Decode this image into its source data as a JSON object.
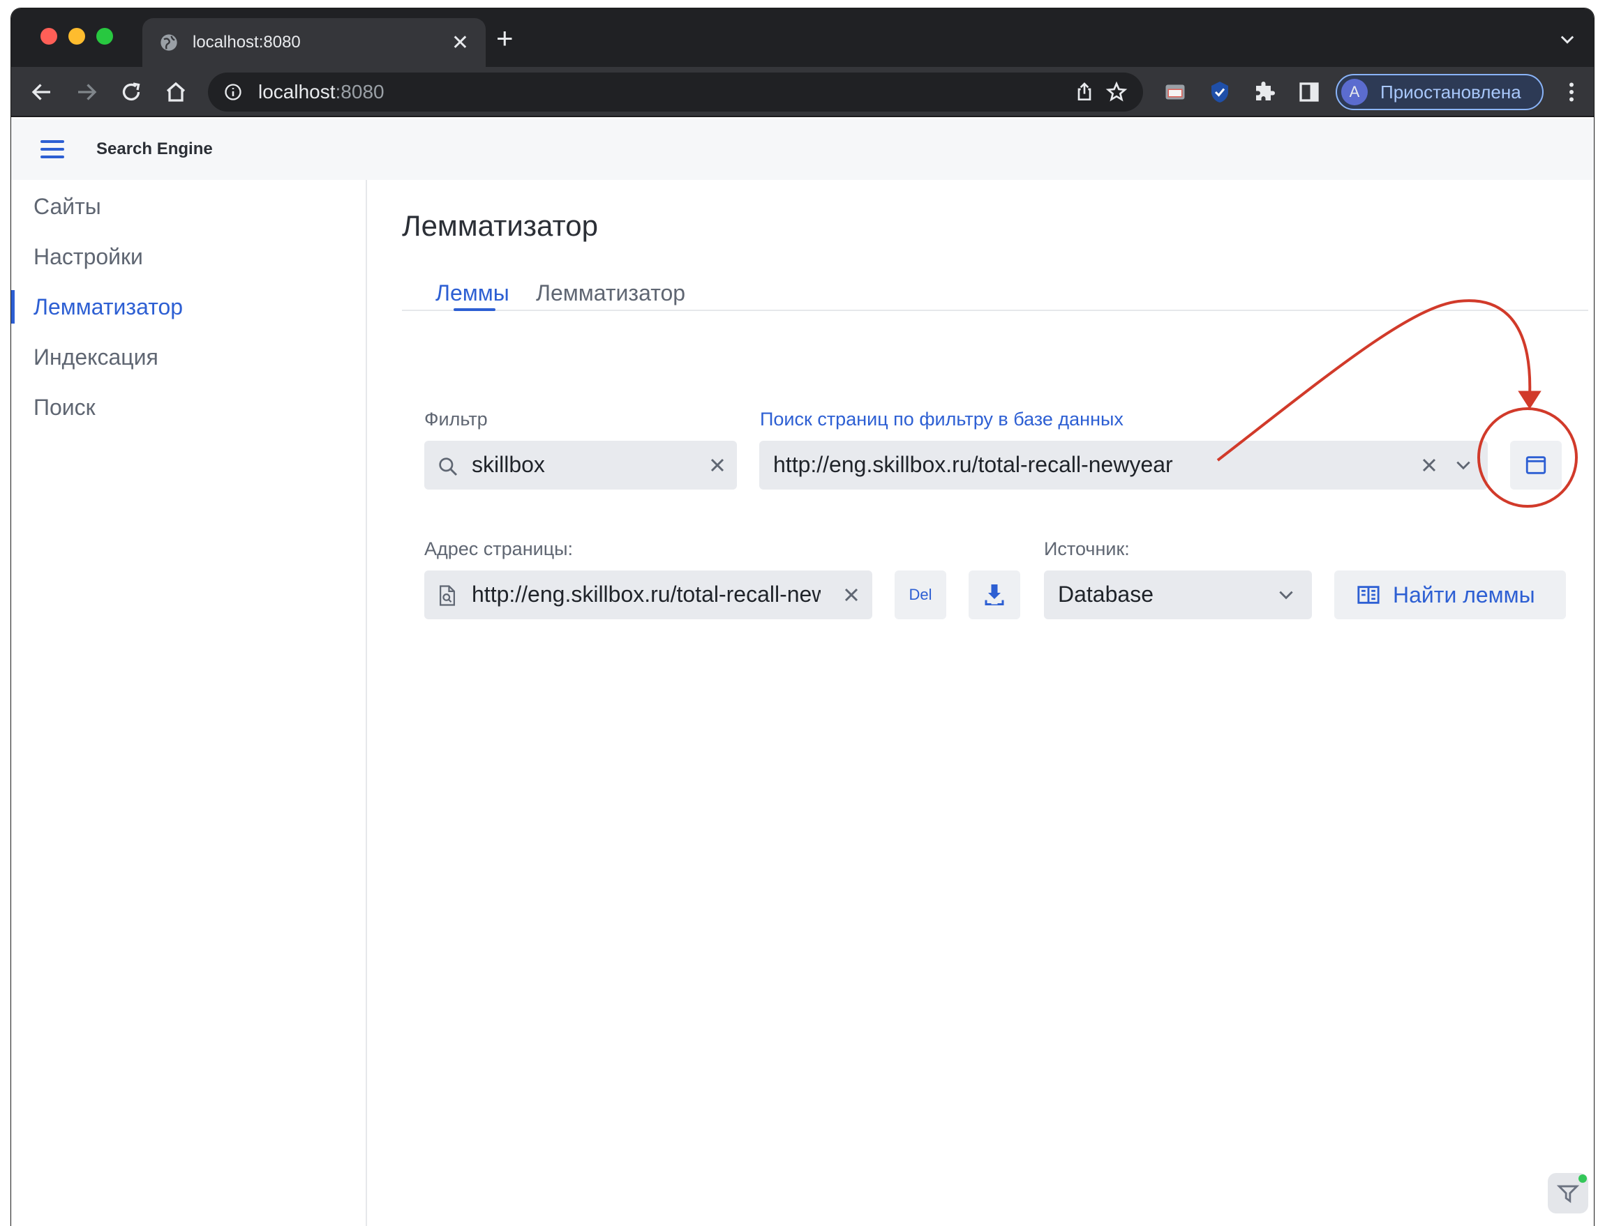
{
  "browser": {
    "tab_title": "localhost:8080",
    "url_host": "localhost",
    "url_port": ":8080",
    "profile_initial": "A",
    "profile_status": "Приостановлена"
  },
  "app": {
    "title": "Search Engine"
  },
  "sidebar": {
    "items": [
      {
        "label": "Сайты"
      },
      {
        "label": "Настройки"
      },
      {
        "label": "Лемматизатор"
      },
      {
        "label": "Индексация"
      },
      {
        "label": "Поиск"
      }
    ]
  },
  "main": {
    "page_title": "Лемматизатор",
    "tabs": [
      {
        "label": "Леммы"
      },
      {
        "label": "Лемматизатор"
      }
    ],
    "filter": {
      "label": "Фильтр",
      "value": "skillbox"
    },
    "db_search": {
      "label": "Поиск страниц по фильтру в базе данных",
      "value": "http://eng.skillbox.ru/total-recall-newyear"
    },
    "page_address": {
      "label": "Адрес страницы:",
      "value": "http://eng.skillbox.ru/total-recall-newyear"
    },
    "del_label": "Del",
    "source": {
      "label": "Источник:",
      "value": "Database"
    },
    "find_label": "Найти леммы"
  },
  "colors": {
    "accent": "#2d5fd3",
    "annotation": "#d13a2a"
  }
}
